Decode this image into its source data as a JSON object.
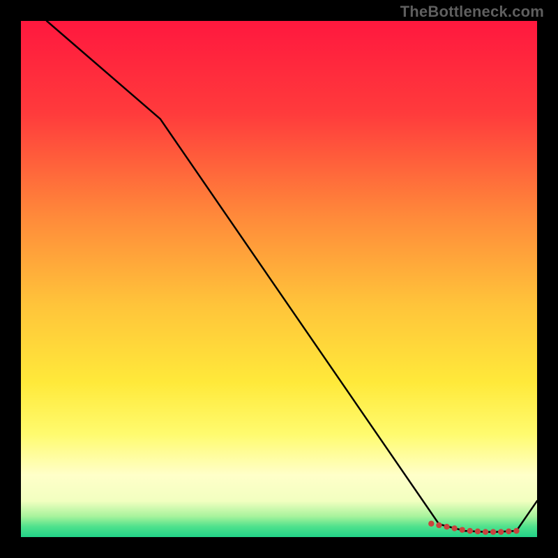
{
  "watermark": "TheBottleneck.com",
  "chart_data": {
    "type": "line",
    "title": "",
    "xlabel": "",
    "ylabel": "",
    "xlim": [
      0,
      100
    ],
    "ylim": [
      0,
      100
    ],
    "gradient_stops": [
      {
        "offset": 0,
        "color": "#ff183e"
      },
      {
        "offset": 18,
        "color": "#ff3b3c"
      },
      {
        "offset": 38,
        "color": "#ff8a3a"
      },
      {
        "offset": 55,
        "color": "#ffc43a"
      },
      {
        "offset": 70,
        "color": "#ffe93a"
      },
      {
        "offset": 80,
        "color": "#fffb6e"
      },
      {
        "offset": 88,
        "color": "#ffffc9"
      },
      {
        "offset": 93,
        "color": "#f2ffc0"
      },
      {
        "offset": 96,
        "color": "#a7f39c"
      },
      {
        "offset": 98,
        "color": "#4ee18c"
      },
      {
        "offset": 100,
        "color": "#21d388"
      }
    ],
    "series": [
      {
        "name": "curve",
        "x": [
          5,
          27,
          81,
          86,
          90,
          92,
          96,
          100
        ],
        "y": [
          100,
          81,
          2.5,
          1.2,
          1.0,
          1.0,
          1.2,
          7
        ]
      }
    ],
    "markers": {
      "name": "bottom-dots",
      "color": "#c9423d",
      "points": [
        {
          "x": 79.5,
          "y": 2.6
        },
        {
          "x": 81.0,
          "y": 2.3
        },
        {
          "x": 82.5,
          "y": 2.0
        },
        {
          "x": 84.0,
          "y": 1.7
        },
        {
          "x": 85.5,
          "y": 1.4
        },
        {
          "x": 87.0,
          "y": 1.2
        },
        {
          "x": 88.5,
          "y": 1.1
        },
        {
          "x": 90.0,
          "y": 1.0
        },
        {
          "x": 91.5,
          "y": 1.0
        },
        {
          "x": 93.0,
          "y": 1.0
        },
        {
          "x": 94.5,
          "y": 1.1
        },
        {
          "x": 96.0,
          "y": 1.2
        }
      ]
    }
  }
}
